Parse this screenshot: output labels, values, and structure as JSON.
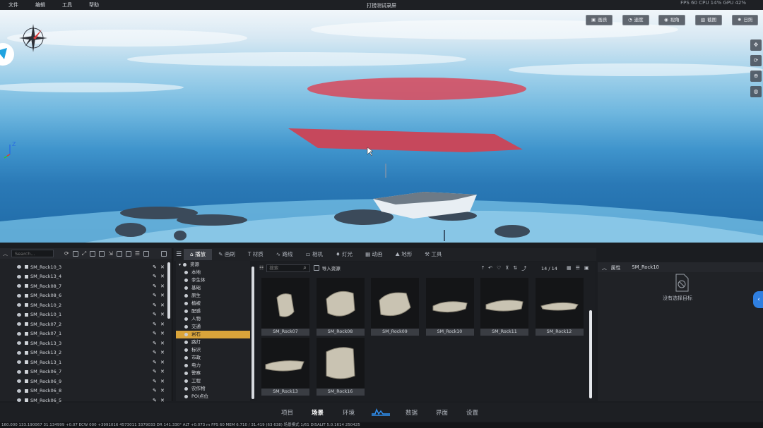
{
  "menu": {
    "items": [
      "文件",
      "编辑",
      "工具",
      "帮助"
    ],
    "window_title": "打捞测试录屏",
    "perf": "FPS 60   CPU 14%   GPU 42%"
  },
  "viewport": {
    "buttons": [
      "画质",
      "速度",
      "视角",
      "截图",
      "日照"
    ],
    "side_tools": [
      "move-icon",
      "orbit-icon",
      "zoom-icon",
      "globe-icon"
    ],
    "axis_label": "Z"
  },
  "outliner": {
    "search_placeholder": "Search...",
    "items": [
      "SM_Rock10_3",
      "SM_Rock13_4",
      "SM_Rock08_7",
      "SM_Rock08_6",
      "SM_Rock10_2",
      "SM_Rock10_1",
      "SM_Rock07_2",
      "SM_Rock07_1",
      "SM_Rock13_3",
      "SM_Rock13_2",
      "SM_Rock13_1",
      "SM_Rock06_7",
      "SM_Rock06_9",
      "SM_Rock06_8",
      "SM_Rock06_5"
    ]
  },
  "tabs": [
    "播放",
    "画刷",
    "材质",
    "路线",
    "相机",
    "灯光",
    "动画",
    "地形",
    "工具"
  ],
  "categories": {
    "root": "资源",
    "items": [
      "本地",
      "孪生体",
      "基础",
      "原生",
      "植被",
      "配感",
      "人物",
      "交通",
      "岩石",
      "路灯",
      "标识",
      "市政",
      "电力",
      "警察",
      "工程",
      "农作物",
      "POI点位"
    ],
    "active": "岩石"
  },
  "assets": {
    "search_placeholder": "搜索",
    "import_label": "导入资源",
    "count": "14 / 14",
    "items": [
      "SM_Rock07",
      "SM_Rock08",
      "SM_Rock09",
      "SM_Rock10",
      "SM_Rock11",
      "SM_Rock12",
      "SM_Rock13",
      "SM_Rock16"
    ]
  },
  "props": {
    "title": "属性",
    "selected": "SM_Rock10",
    "empty_text": "没有选择目标"
  },
  "bottom_nav": {
    "items": [
      "项目",
      "场景",
      "环境",
      "",
      "数据",
      "界面",
      "设置"
    ],
    "active": "场景"
  },
  "status": "160.000  133.190067 31.134999 +0.07   ECW 000   +3991016 4573011 3379033 DR   141.330°   ALT   +0.073 m   FPS 60   MEM 6.710 / 31.419 (63 638)     场景模式   1/61     DISALIT  5.0.1614 250425"
}
